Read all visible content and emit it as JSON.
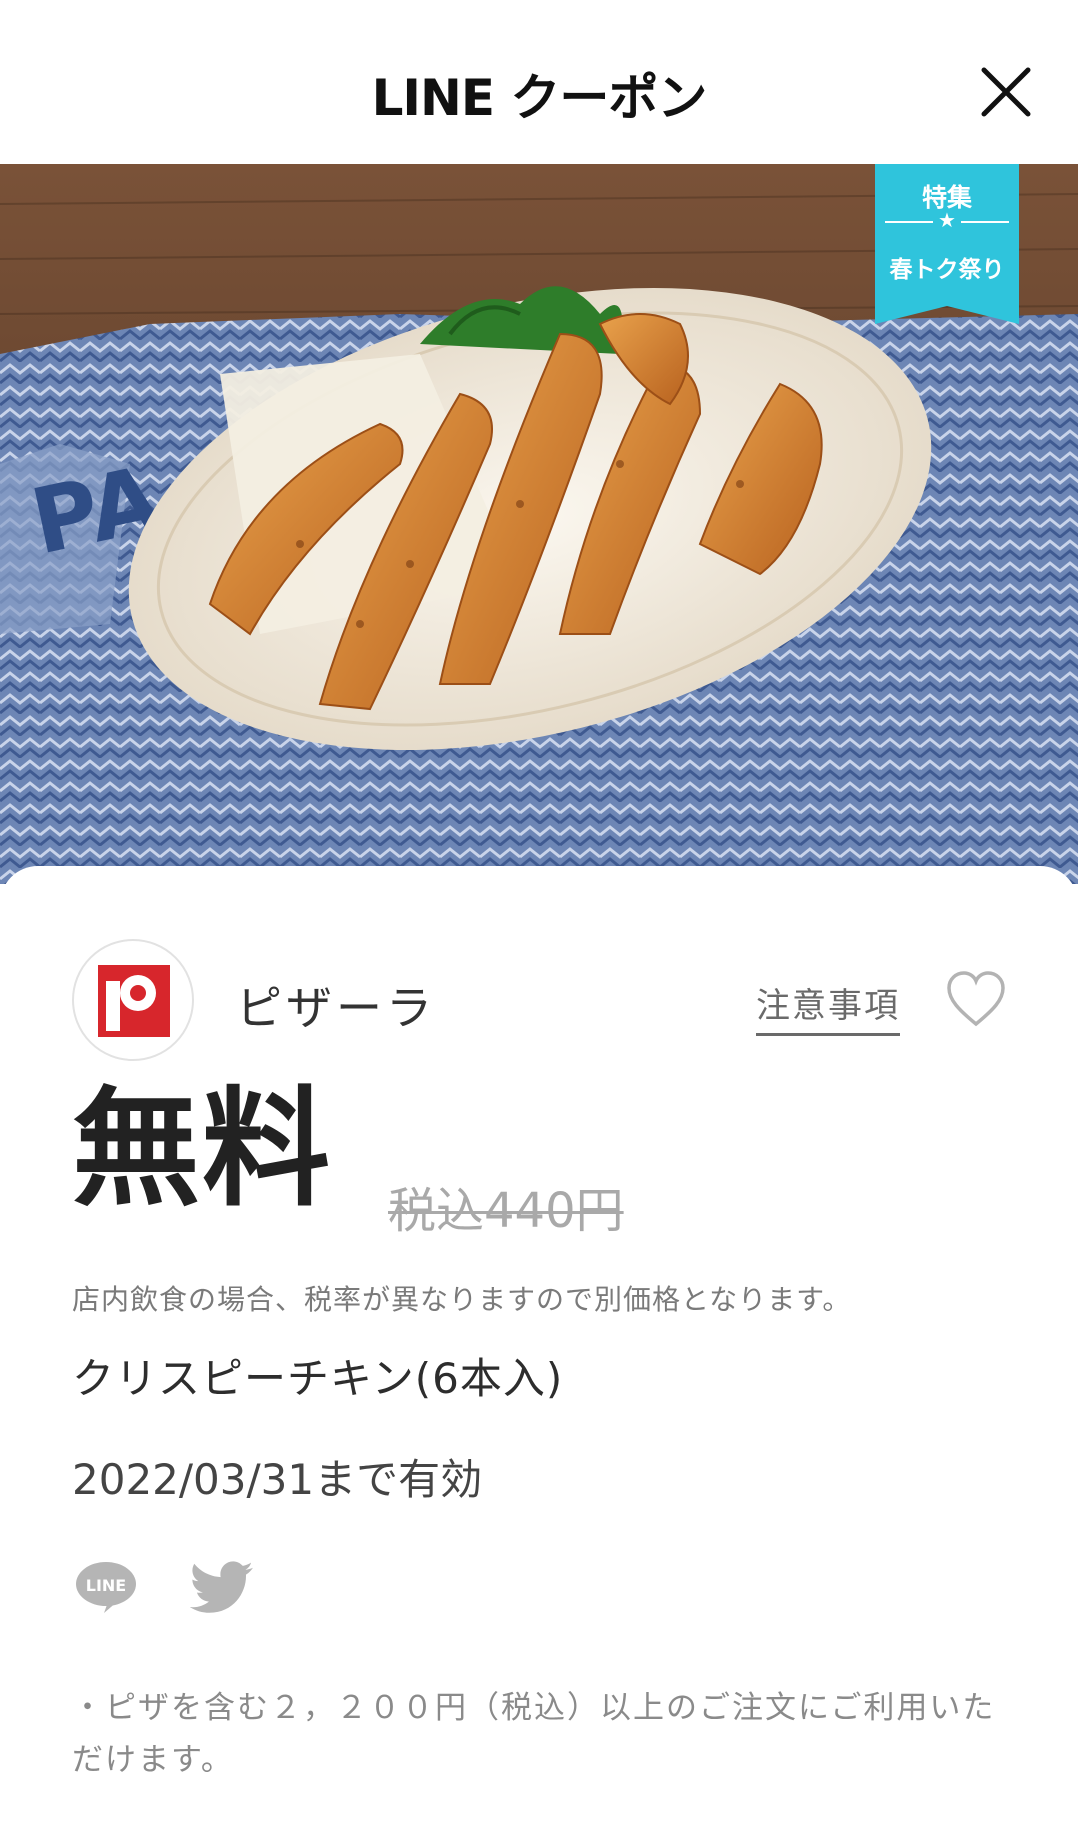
{
  "header": {
    "title": "LINE クーポン"
  },
  "badge": {
    "category": "特集",
    "star": "★",
    "campaign": "春トク祭り",
    "color": "#2fc4dc"
  },
  "shop": {
    "name": "ピザーラ",
    "notes_label": "注意事項",
    "logo_color": "#d7262c"
  },
  "coupon": {
    "price": "無料",
    "original_price": "税込440円",
    "tax_note": "店内飲食の場合、税率が異なりますので別価格となります。",
    "product": "クリスピーチキン(6本入)",
    "validity": "2022/03/31まで有効"
  },
  "share": {
    "line_label": "LINE",
    "line_icon": "line-icon",
    "twitter_icon": "twitter-icon"
  },
  "terms": {
    "text": "・ピザを含む２，２００円（税込）以上のご注文にご利用いただけます。"
  }
}
